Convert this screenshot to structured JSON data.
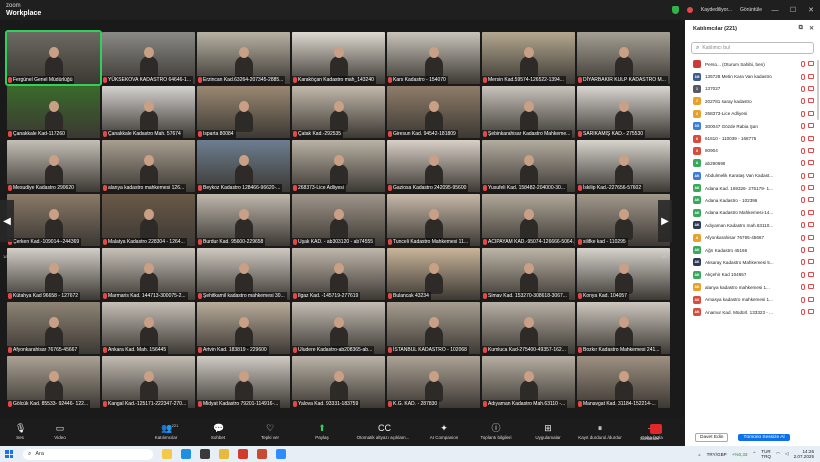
{
  "app": {
    "logo_line1": "zoom",
    "logo_line2": "Workplace"
  },
  "titlebar": {
    "recording": "Kaydediliyor...",
    "view": "Görüntüle",
    "min": "—",
    "max": "☐",
    "close": "✕"
  },
  "gallery": {
    "page_left": "1/5",
    "page_right": "1/5",
    "tiles": [
      {
        "name": "Fergünel Genel Müdürlüğü",
        "bg": "#6b6a62",
        "active": true
      },
      {
        "name": "YÜKSEKOVA KADASTRO 64646-1...",
        "bg": "#8a8a86"
      },
      {
        "name": "Erzincan Kad.63264-207345-2885...",
        "bg": "#b8b2a4"
      },
      {
        "name": "Karaköçan Kadastro mah_143240",
        "bg": "#ded9d0"
      },
      {
        "name": "Kars Kadastro - 154070",
        "bg": "#c9c4bb"
      },
      {
        "name": "Mersin Kad.59574-126522-1394...",
        "bg": "#b4a890"
      },
      {
        "name": "DİYARBAKIR KULP KADASTRO M...",
        "bg": "#a5a095"
      },
      {
        "name": "Çanakkale Kad-117260",
        "bg": "#3a6a2a"
      },
      {
        "name": "Çanakkale Kadastro Mah. 57674",
        "bg": "#d4d2cf"
      },
      {
        "name": "Isparta 80084",
        "bg": "#9a8872"
      },
      {
        "name": "Çatak Kad.-292535",
        "bg": "#c2b9ab"
      },
      {
        "name": "Giresun Kad. 94542-181809",
        "bg": "#8f7d6a"
      },
      {
        "name": "Şebinkarahisar Kadastro Mahkeme...",
        "bg": "#c8c3bb"
      },
      {
        "name": "SARIKAMIŞ KAD.- 275530",
        "bg": "#d9d5d0"
      },
      {
        "name": "Mesudiye Kadastro 290620",
        "bg": "#c4bfb6"
      },
      {
        "name": "alanya kadastro mahkemesi 126...",
        "bg": "#a89f90"
      },
      {
        "name": "Beykoz Kadastro 128466-96620-...",
        "bg": "#6d7e90"
      },
      {
        "name": "268373-Lice Adliyesi",
        "bg": "#b9b2a5"
      },
      {
        "name": "Gaziosa Kadastro 242095-95600",
        "bg": "#d8cfc7"
      },
      {
        "name": "Yusufeli Kad. 158482-204000-30...",
        "bg": "#b3aca0"
      },
      {
        "name": "İskilip Kad.-227656-57602",
        "bg": "#d7d3cd"
      },
      {
        "name": "Çerken Kad.-109014--244369",
        "bg": "#8a7a68"
      },
      {
        "name": "Malatya Kadastro 228304 - 1264...",
        "bg": "#6a5a48"
      },
      {
        "name": "Burdur Kad. 95600-229658",
        "bg": "#bfb8ad"
      },
      {
        "name": "Uşak KAD. - ab303120 - ab74555",
        "bg": "#9f968a"
      },
      {
        "name": "Tunceli Kadastro Mahkemesi 11...",
        "bg": "#c6b9a9"
      },
      {
        "name": "ACIPAYAM KAD.-95074-126666-5064...",
        "bg": "#b0a89a"
      },
      {
        "name": "silifke kad - 110295",
        "bg": "#a2998c"
      },
      {
        "name": "Kütahya Kad 96658 - 127672",
        "bg": "#d3cec7"
      },
      {
        "name": "Marmaris Kad. 144713-300075-2...",
        "bg": "#c7c1b8"
      },
      {
        "name": "Şehitkamil kadastro mahkemesi 30...",
        "bg": "#cfc9c1"
      },
      {
        "name": "Ilgaz Kad. -145719-277619",
        "bg": "#bfb7ab"
      },
      {
        "name": "Bulancak 43234",
        "bg": "#c9b59a"
      },
      {
        "name": "Simav Kad. 153270-308618-3067...",
        "bg": "#bdb5a8"
      },
      {
        "name": "Konya Kad. 104057",
        "bg": "#d6d2cc"
      },
      {
        "name": "Afyonkarahisar 76765-45667",
        "bg": "#8e8475"
      },
      {
        "name": "Ankara Kad. Mah. 156445",
        "bg": "#c5bfb6"
      },
      {
        "name": "Artvin Kad. 183819 - 229600",
        "bg": "#b8ab9a"
      },
      {
        "name": "Uludere Kadastro-ab208365-ab...",
        "bg": "#c3bdb4"
      },
      {
        "name": "İSTANBUL KADASTRO - 102068",
        "bg": "#a79e90"
      },
      {
        "name": "Kumluca Kad-275400-49357-162...",
        "bg": "#b8b1a6"
      },
      {
        "name": "Bozkır Kadastro Mahkemesi 241...",
        "bg": "#cdc7be"
      },
      {
        "name": "Gölcük Kad. 85533- 92446- 122...",
        "bg": "#aaa295"
      },
      {
        "name": "Kangal Kad.-125171-222347-270...",
        "bg": "#c2bcb3"
      },
      {
        "name": "Midyat Kadastro 79201-114916-...",
        "bg": "#d0cbc4"
      },
      {
        "name": "Yalova Kad. 93331-183759",
        "bg": "#bcb4a8"
      },
      {
        "name": "K.G. KAD. - 287830",
        "bg": "#aca396"
      },
      {
        "name": "Adıyaman Kadastro Mah.63110 -...",
        "bg": "#b6aea2"
      },
      {
        "name": "Manavgat Kad. 31184-152214-...",
        "bg": "#9e9182"
      }
    ]
  },
  "toolbar": {
    "items": [
      {
        "label": "Ses",
        "icon": "🎙"
      },
      {
        "label": "Video",
        "icon": "▭"
      },
      {
        "label": "Katılımcılar",
        "icon": "👥",
        "count": "221"
      },
      {
        "label": "Sohbet",
        "icon": "💬"
      },
      {
        "label": "Tepki ver",
        "icon": "♡"
      },
      {
        "label": "Paylaş",
        "icon": "⬆"
      },
      {
        "label": "Otomatik altyazı açıklam...",
        "icon": "CC"
      },
      {
        "label": "AI Companion",
        "icon": "✦"
      },
      {
        "label": "Toplantı bilgileri",
        "icon": "ⓘ"
      },
      {
        "label": "Uygulamalar",
        "icon": "⊞"
      },
      {
        "label": "Kayıt durdurul./durdur",
        "icon": "⏸"
      },
      {
        "label": "Daha fazla",
        "icon": "⋯"
      }
    ],
    "end_label": "Sonlandır"
  },
  "panel": {
    "title": "Katılımcılar (221)",
    "search_placeholder": "Katılımcı bul",
    "invite": "Davet Edin",
    "mute_all": "Tümünü Sessize Al",
    "participants": [
      {
        "initials": "",
        "name": "Perso... (Oturum Sahibi, ben)",
        "color": "#cc3b3b"
      },
      {
        "initials": "1M",
        "name": "135728 Metin Kara Van kadastro",
        "color": "#3b5b8f"
      },
      {
        "initials": "1",
        "name": "137027",
        "color": "#555a66"
      },
      {
        "initials": "2",
        "name": "202781 saray kadastro",
        "color": "#e8a02a"
      },
      {
        "initials": "2",
        "name": "268373-Lice Adliyesi",
        "color": "#e8a02a"
      },
      {
        "initials": "3G",
        "name": "300047 Gözde Rabia Şan",
        "color": "#3b7dd8"
      },
      {
        "initials": "6",
        "name": "61610 - 110039 - 168775",
        "color": "#d94b3b"
      },
      {
        "initials": "8",
        "name": "80904",
        "color": "#d94b3b"
      },
      {
        "initials": "A",
        "name": "ab290699",
        "color": "#3aa85c"
      },
      {
        "initials": "AK",
        "name": "Abdulmelik Karataş Van Kadast...",
        "color": "#3b7dd8"
      },
      {
        "initials": "AK",
        "name": "Adana Kad. 169326- 276179- 1...",
        "color": "#3aa85c"
      },
      {
        "initials": "AK",
        "name": "Adana Kadastro - 102396",
        "color": "#3aa85c"
      },
      {
        "initials": "AK",
        "name": "Adana Kadastro Mahkemesi-14...",
        "color": "#3aa85c"
      },
      {
        "initials": "AK",
        "name": "Adıyaman Kadastro mah.63110...",
        "color": "#2d3a55"
      },
      {
        "initials": "A",
        "name": "Afyonkarahisar 76765-45667",
        "color": "#e8a02a"
      },
      {
        "initials": "AK",
        "name": "Ağrı Kadastro 45166",
        "color": "#3aa85c"
      },
      {
        "initials": "AK",
        "name": "Aksaray Kadastro Mahkemesi 5...",
        "color": "#2d3a55"
      },
      {
        "initials": "AK",
        "name": "Akçehir Kad 104657",
        "color": "#3aa85c"
      },
      {
        "initials": "AK",
        "name": "alanya kadastro mahkemesi 1...",
        "color": "#e8a02a"
      },
      {
        "initials": "AK",
        "name": "Amasya kadastro mahkemesi 1...",
        "color": "#d94b3b"
      },
      {
        "initials": "AK",
        "name": "Anamur Kad. Müdürl. 133323 - ...",
        "color": "#d94b3b"
      }
    ]
  },
  "taskbar": {
    "search": "Ara",
    "tray_currency": "TRY/GBP",
    "tray_change": "+%0,33",
    "tray_lang": "TUR",
    "tray_lang2": "TRQ",
    "time": "14:26",
    "date": "2.07.2025"
  },
  "colors": {
    "active_speaker": "#2fd05c",
    "end": "#e02828",
    "accent": "#0e71eb"
  }
}
